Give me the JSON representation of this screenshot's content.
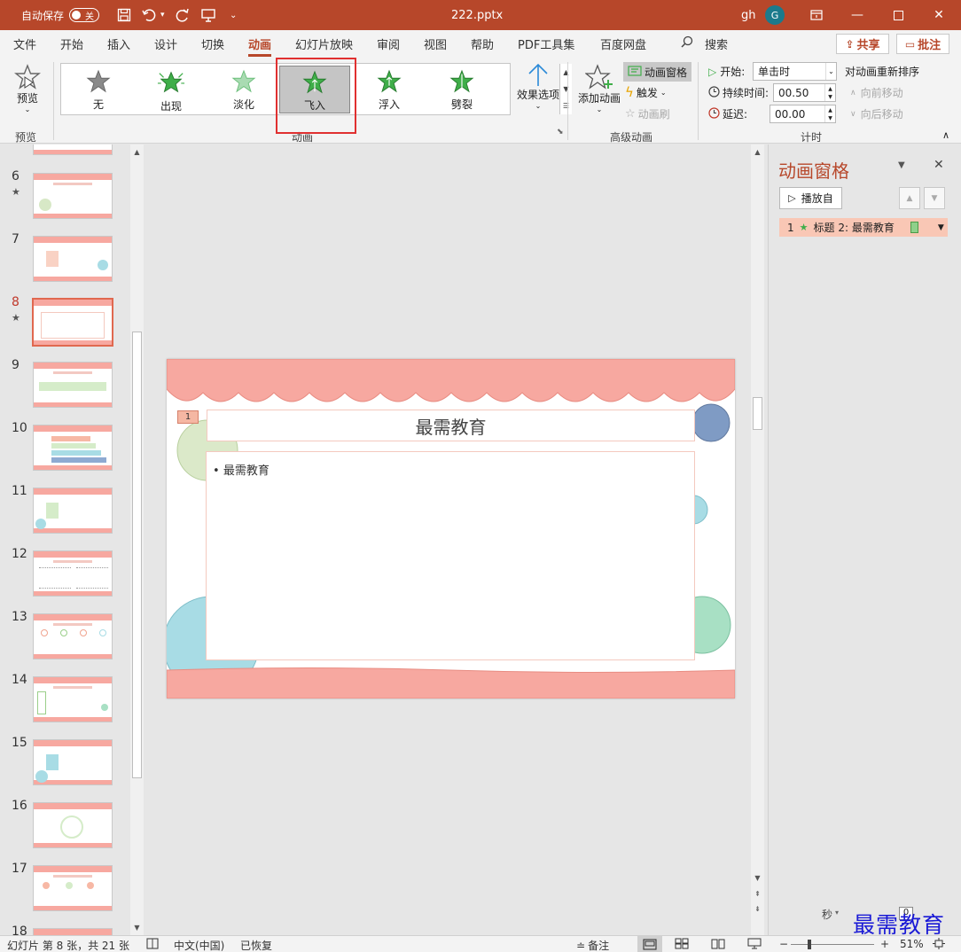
{
  "titlebar": {
    "autosave_label": "自动保存",
    "autosave_state": "关",
    "filename": "222.pptx",
    "user_name": "gh",
    "avatar_initial": "G"
  },
  "menu": {
    "tabs": [
      "文件",
      "开始",
      "插入",
      "设计",
      "切换",
      "动画",
      "幻灯片放映",
      "审阅",
      "视图",
      "帮助",
      "PDF工具集",
      "百度网盘"
    ],
    "active_tab": "动画",
    "search_label": "搜索",
    "share_label": "共享",
    "comment_label": "批注"
  },
  "ribbon": {
    "preview_label": "预览",
    "preview_group": "预览",
    "animation_group": "动画",
    "gallery": [
      {
        "label": "无",
        "color": "#8a8a8a"
      },
      {
        "label": "出现",
        "color": "#3fae49"
      },
      {
        "label": "淡化",
        "color": "#7cc58a"
      },
      {
        "label": "飞入",
        "color": "#3fae49"
      },
      {
        "label": "浮入",
        "color": "#3fae49"
      },
      {
        "label": "劈裂",
        "color": "#3fae49"
      }
    ],
    "selected_effect": "飞入",
    "effect_options_label": "效果选项",
    "add_animation_label": "添加动画",
    "animation_pane_label": "动画窗格",
    "trigger_label": "触发",
    "animation_painter_label": "动画刷",
    "advanced_group": "高级动画",
    "start_label": "开始:",
    "start_value": "单击时",
    "duration_label": "持续时间:",
    "duration_value": "00.50",
    "delay_label": "延迟:",
    "delay_value": "00.00",
    "reorder_label": "对动画重新排序",
    "move_earlier_label": "向前移动",
    "move_later_label": "向后移动",
    "timing_group": "计时"
  },
  "thumbnails": [
    {
      "num": "6",
      "star": "★"
    },
    {
      "num": "7",
      "star": ""
    },
    {
      "num": "8",
      "star": "★"
    },
    {
      "num": "9",
      "star": ""
    },
    {
      "num": "10",
      "star": ""
    },
    {
      "num": "11",
      "star": ""
    },
    {
      "num": "12",
      "star": ""
    },
    {
      "num": "13",
      "star": ""
    },
    {
      "num": "14",
      "star": ""
    },
    {
      "num": "15",
      "star": ""
    },
    {
      "num": "16",
      "star": ""
    },
    {
      "num": "17",
      "star": ""
    },
    {
      "num": "18",
      "star": ""
    }
  ],
  "active_slide": "8",
  "slide": {
    "anim_tag": "1",
    "title": "最需教育",
    "bullet": "最需教育"
  },
  "animation_pane": {
    "title": "动画窗格",
    "play_label": "播放自",
    "item_index": "1",
    "item_label": "标题 2: 最需教育",
    "seconds_label": "秒",
    "seconds_value": "0"
  },
  "statusbar": {
    "slide_info": "幻灯片 第 8 张，共 21 张",
    "language": "中文(中国)",
    "recovery": "已恢复",
    "notes_label": "备注",
    "zoom": "51%"
  },
  "watermark": "最需教育"
}
